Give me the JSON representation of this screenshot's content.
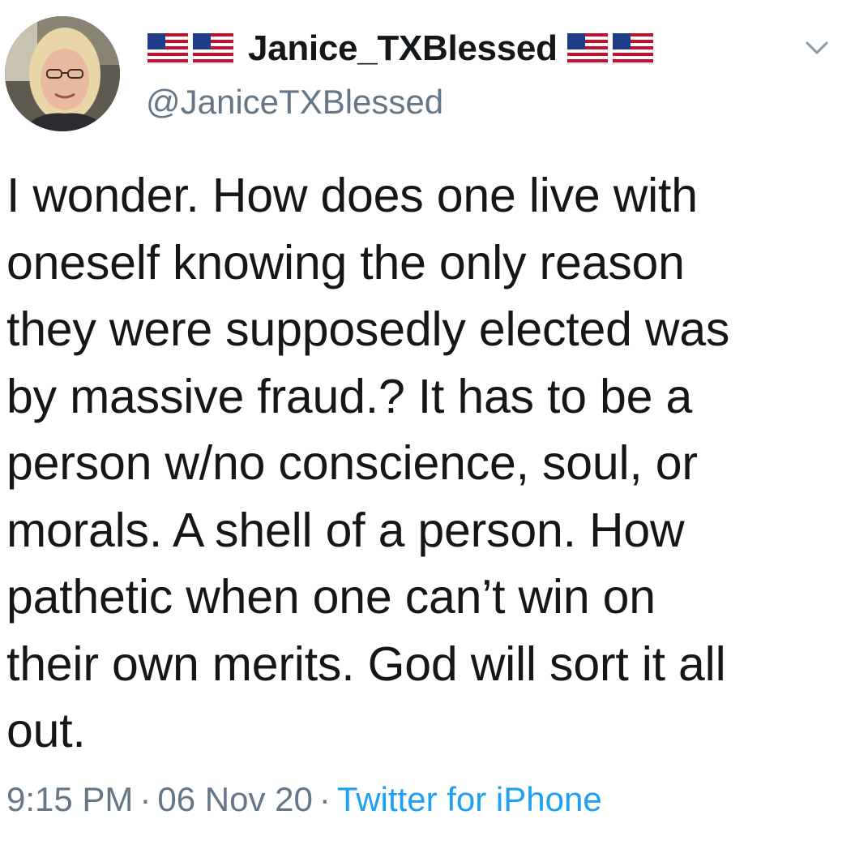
{
  "author": {
    "display_name": "Janice_TXBlessed",
    "handle": "@JaniceTXBlessed",
    "name_emoji_left": [
      "us-flag-icon",
      "us-flag-icon"
    ],
    "name_emoji_right": [
      "us-flag-icon",
      "us-flag-icon"
    ]
  },
  "tweet": {
    "text": "I wonder. How does one live with\noneself knowing the only reason\nthey were supposedly elected was\nby massive fraud.? It has to be a\nperson w/no conscience, soul, or\nmorals. A shell of a person. How\npathetic when one can’t win on\ntheir own merits. God will sort it all\nout.",
    "time": "9:15 PM",
    "separator": "·",
    "date": "06 Nov 20",
    "source": "Twitter for iPhone"
  },
  "icons": {
    "caret": "chevron-down-icon"
  },
  "colors": {
    "text": "#14171a",
    "secondary": "#657786",
    "link": "#1da1f2",
    "background": "#ffffff"
  }
}
